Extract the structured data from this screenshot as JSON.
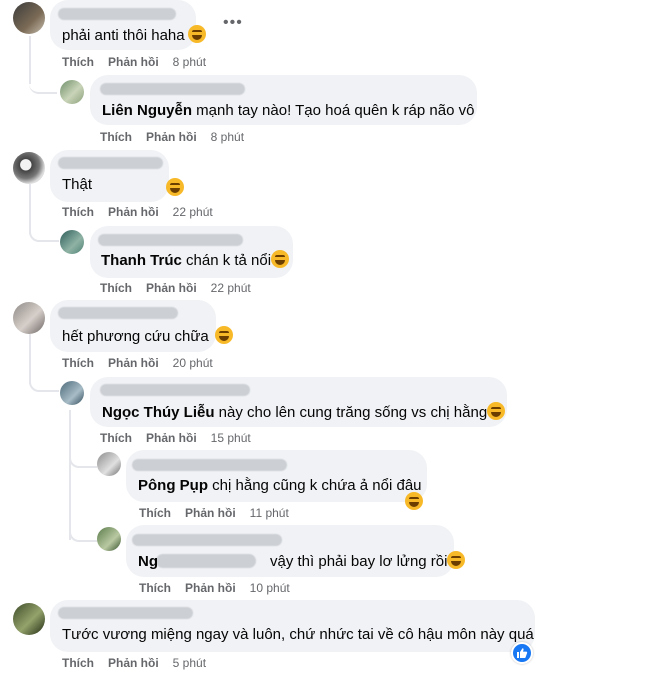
{
  "comments": [
    {
      "text": "phải anti thôi haha",
      "like_label": "Thích",
      "reply_label": "Phản hồi",
      "time": "8 phút"
    },
    {
      "author": "Liên Nguyễn",
      "text": " mạnh tay nào! Tạo hoá quên k ráp não vô",
      "like_label": "Thích",
      "reply_label": "Phản hồi",
      "time": "8 phút"
    },
    {
      "text": "Thật",
      "like_label": "Thích",
      "reply_label": "Phản hồi",
      "time": "22 phút"
    },
    {
      "author": "Thanh Trúc",
      "text": " chán k tả nổi",
      "like_label": "Thích",
      "reply_label": "Phản hồi",
      "time": "22 phút"
    },
    {
      "text": "hết phương cứu chữa",
      "like_label": "Thích",
      "reply_label": "Phản hồi",
      "time": "20 phút"
    },
    {
      "author": "Ngọc Thúy Liễu",
      "text": " này cho lên cung trăng sống vs chị hằng",
      "like_label": "Thích",
      "reply_label": "Phản hồi",
      "time": "15 phút"
    },
    {
      "author": "Pông Pụp",
      "text": " chị hằng cũng k chứa ả nổi đâu",
      "like_label": "Thích",
      "reply_label": "Phản hồi",
      "time": "11 phút"
    },
    {
      "author": "Ng",
      "text": "vậy thì phải bay lơ lửng rồi",
      "like_label": "Thích",
      "reply_label": "Phản hồi",
      "time": "10 phút"
    },
    {
      "text": "Tước vương miệng ngay và luôn, chứ nhức tai về cô hậu môn này quá",
      "like_label": "Thích",
      "reply_label": "Phản hồi",
      "time": "5 phút"
    }
  ],
  "icons": {
    "more": "more-dots-icon",
    "emoji": "laughing-emoji-icon",
    "reaction": "like-reaction-icon"
  },
  "colors": {
    "bubble": "#f0f2f5",
    "meta": "#65676b",
    "like_blue": "#1877f2"
  },
  "more_label": "•••"
}
